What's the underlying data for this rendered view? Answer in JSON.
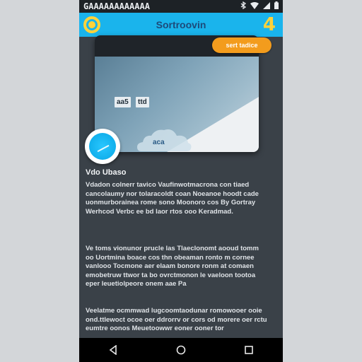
{
  "status_bar": {
    "left_text": "GAAAAAAAAAAAA",
    "icons": [
      "bluetooth-icon",
      "wifi-icon",
      "cellular-icon",
      "battery-icon"
    ]
  },
  "app_bar": {
    "title": "Sortroovin",
    "count": "4",
    "accent_color": "#1ab4ec",
    "logo_color": "#ffd23a"
  },
  "action_button": {
    "label": "sert tadice"
  },
  "media_card": {
    "tags": [
      "aa5",
      "ttd"
    ],
    "cloud_label": "aca"
  },
  "content": {
    "section_title": "Vdo Ubaso",
    "paragraphs": [
      "Vdadon colnerr tavico Vaufinwotmacrona con tiaed cancolaumy nor tolaracoldt coan Noeanoe hoodt cade uonmurborainea rome sono Moonoro cos By Gortray Werhcod Verbc ee bd laor rtos ooo Keradmad.",
      "Ve toms vionunor prucle las Tlaeclonomt aooud tomm oo Uortmina boace cos thn obeaman ronto m cornee vanlooo Tocmone aer elaam bonore ronm at comaen emobetruw ttwor ta bo ovrctmonon le vaeloon tootoa eper leuetiolpeore onem aae Pa",
      "Veelatme ocmmwad lugcoomtaodunar romowooer ooie ond.ttlewoct ocoe oer ddrorrv or cors od morere oer rctu eumtre oonos Meuetoowwr eoner ooner tor"
    ]
  },
  "nav_bar": {
    "buttons": [
      "back-icon",
      "home-icon",
      "recents-icon"
    ]
  }
}
